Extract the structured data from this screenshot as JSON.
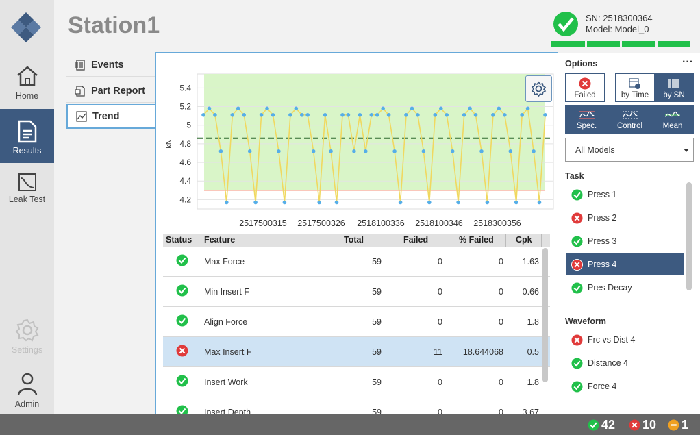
{
  "header": {
    "station": "Station1",
    "sn": "SN: 2518300364",
    "model": "Model: Model_0"
  },
  "nav": [
    {
      "label": "Home",
      "icon": "home-icon"
    },
    {
      "label": "Results",
      "icon": "document-icon"
    },
    {
      "label": "Leak Test",
      "icon": "leak-test-icon"
    },
    {
      "label": "Settings",
      "icon": "gear-icon"
    },
    {
      "label": "Admin",
      "icon": "user-icon"
    }
  ],
  "subnav": [
    {
      "label": "Events",
      "icon": "events-icon"
    },
    {
      "label": "Part Report",
      "icon": "part-report-icon"
    },
    {
      "label": "Trend",
      "icon": "trend-icon"
    }
  ],
  "chart_data": {
    "type": "line",
    "ylabel": "kN",
    "ylim": [
      4.1,
      5.55
    ],
    "yticks": [
      "5.4",
      "5.2",
      "5",
      "4.8",
      "4.6",
      "4.4",
      "4.2"
    ],
    "xticks": [
      "2517500315",
      "2517500326",
      "2518100336",
      "2518100346",
      "2518300356"
    ],
    "mean": 4.86,
    "lower_limit": 4.3,
    "colors": {
      "line": "#f0d860",
      "point": "#56aee8",
      "mean": "#2f6b2f",
      "limit": "#f06a4a",
      "band": "#d9f5c8"
    },
    "values": [
      5.11,
      5.18,
      5.11,
      4.72,
      4.17,
      5.11,
      5.18,
      5.11,
      4.72,
      4.17,
      5.11,
      5.18,
      5.11,
      4.72,
      4.17,
      5.11,
      5.18,
      5.11,
      5.11,
      4.72,
      4.17,
      5.11,
      4.72,
      4.17,
      5.11,
      5.11,
      4.72,
      5.11,
      4.72,
      5.11,
      5.11,
      5.18,
      5.11,
      4.72,
      4.17,
      5.11,
      5.18,
      5.11,
      4.72,
      4.17,
      5.11,
      5.18,
      5.11,
      4.72,
      4.17,
      5.11,
      5.18,
      5.11,
      4.72,
      4.17,
      5.11,
      5.18,
      5.11,
      4.72,
      4.17,
      5.11,
      5.18,
      4.72,
      4.17,
      5.11
    ]
  },
  "table": {
    "headers": [
      "Status",
      "Feature",
      "Total",
      "Failed",
      "% Failed",
      "Cpk"
    ],
    "rows": [
      {
        "status": "ok",
        "feature": "Max Force",
        "total": "59",
        "failed": "0",
        "pct": "0",
        "cpk": "1.63"
      },
      {
        "status": "ok",
        "feature": "Min Insert F",
        "total": "59",
        "failed": "0",
        "pct": "0",
        "cpk": "0.66"
      },
      {
        "status": "ok",
        "feature": "Align Force",
        "total": "59",
        "failed": "0",
        "pct": "0",
        "cpk": "1.8"
      },
      {
        "status": "fail",
        "feature": "Max Insert F",
        "total": "59",
        "failed": "11",
        "pct": "18.644068",
        "cpk": "0.5"
      },
      {
        "status": "ok",
        "feature": "Insert Work",
        "total": "59",
        "failed": "0",
        "pct": "0",
        "cpk": "1.8"
      },
      {
        "status": "ok",
        "feature": "Insert Depth",
        "total": "59",
        "failed": "0",
        "pct": "0",
        "cpk": "3.67"
      }
    ]
  },
  "options": {
    "title": "Options",
    "more": "···",
    "buttons": {
      "failed": "Failed",
      "by_time": "by Time",
      "by_sn": "by SN",
      "spec": "Spec.",
      "control": "Control",
      "mean": "Mean"
    },
    "select": "All Models",
    "task_label": "Task",
    "tasks": [
      {
        "label": "Press 1",
        "status": "ok"
      },
      {
        "label": "Press 2",
        "status": "fail"
      },
      {
        "label": "Press 3",
        "status": "ok"
      },
      {
        "label": "Press 4",
        "status": "fail"
      },
      {
        "label": "Pres Decay",
        "status": "ok"
      }
    ],
    "waveform_label": "Waveform",
    "waveforms": [
      {
        "label": "Frc vs Dist 4",
        "status": "fail"
      },
      {
        "label": "Distance 4",
        "status": "ok"
      },
      {
        "label": "Force 4",
        "status": "ok"
      }
    ]
  },
  "footer": {
    "ok": "42",
    "fail": "10",
    "warn": "1"
  },
  "colors": {
    "accent": "#3d5a80",
    "ok": "#21c04a",
    "fail": "#e03a3a",
    "warn": "#f0a020"
  }
}
